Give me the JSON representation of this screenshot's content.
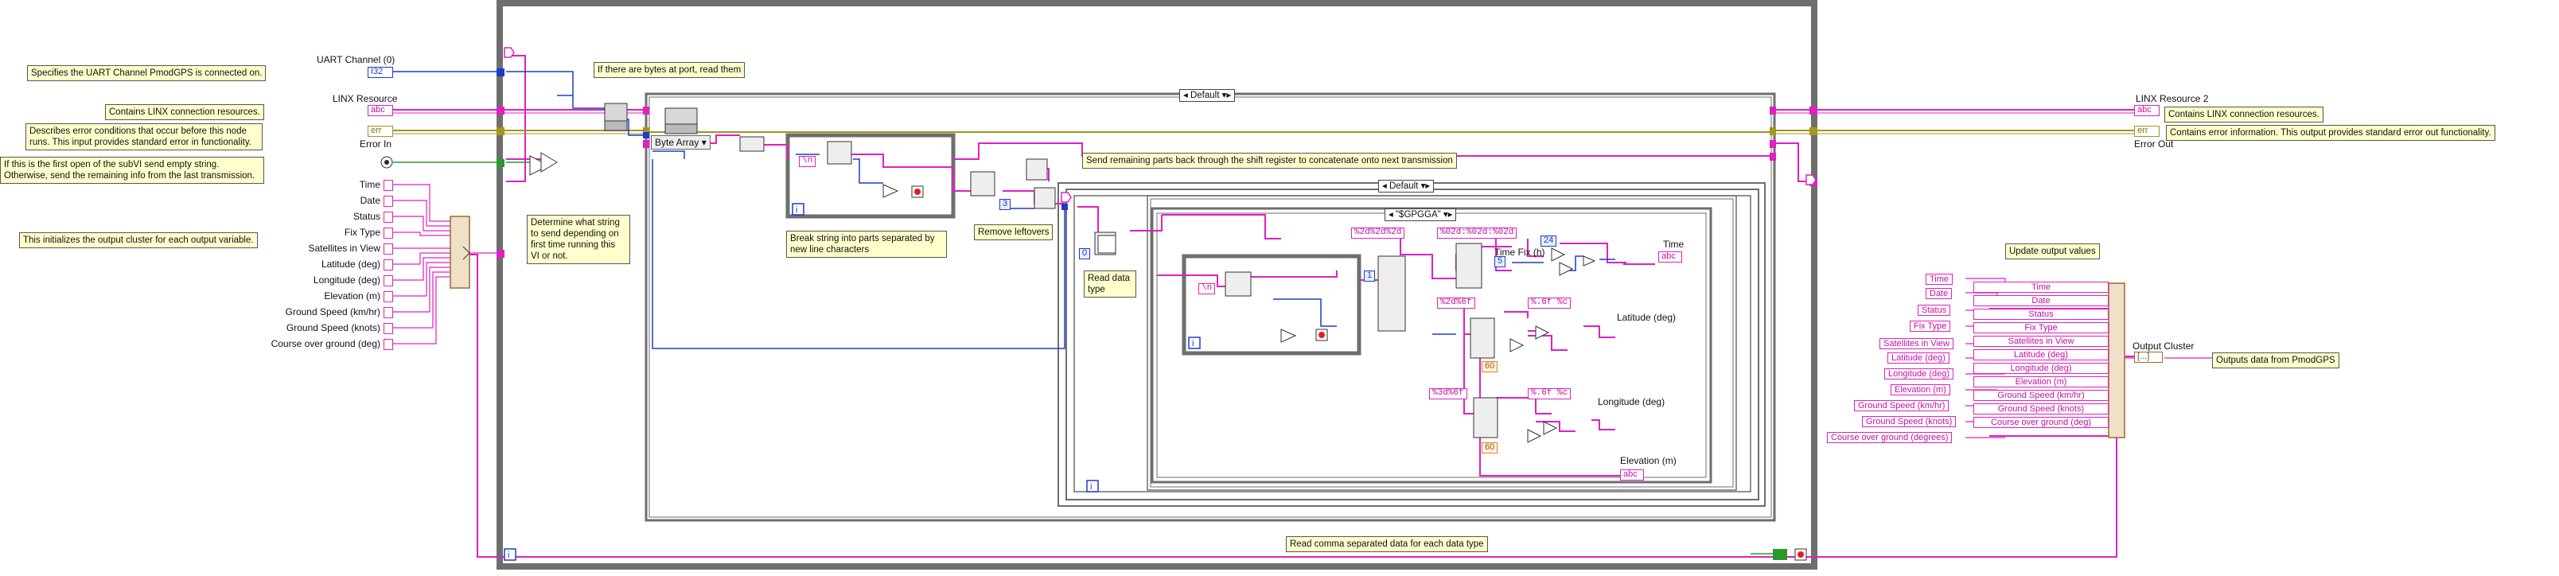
{
  "notes": {
    "uart": "Specifies the UART Channel PmodGPS is connected on.",
    "linx_in": "Contains LINX connection resources.",
    "error_in": [
      "Describes error conditions that occur before this node",
      "runs.  This input provides standard error in functionality."
    ],
    "first_open": [
      "If this is the first open of the subVI send empty string.",
      "Otherwise, send the remaining info from the last transmission."
    ],
    "init_cluster": "This initializes the output cluster for each output variable.",
    "determine": [
      "Determine what string",
      "to send depending on",
      "first time running this",
      "VI or not."
    ],
    "bytes_at_port": "If there are bytes at port, read them",
    "break_string": [
      "Break string into parts separated by",
      "new line characters"
    ],
    "remove_leftovers": "Remove leftovers",
    "send_remaining": "Send remaining parts back through the shift register to concatenate onto next transmission",
    "read_type": [
      "Read data",
      "type"
    ],
    "read_comma": "Read comma separated data for each data type",
    "update_output": "Update output values",
    "linx_out": "Contains LINX connection resources.",
    "error_out": "Contains error information.  This output provides standard error out functionality.",
    "outputs_pmod": "Outputs data from PmodGPS"
  },
  "terminals": {
    "uart_channel": "UART Channel (0)",
    "linx_resource": "LINX Resource",
    "error_in": "Error In",
    "linx_resource_2": "LINX Resource 2",
    "error_out": "Error Out",
    "output_cluster": "Output Cluster"
  },
  "init_fields": [
    "Time",
    "Date",
    "Status",
    "Fix Type",
    "Satellites in View",
    "Latitude (deg)",
    "Longitude (deg)",
    "Elevation (m)",
    "Ground Speed (km/hr)",
    "Ground Speed (knots)",
    "Course over ground (deg)"
  ],
  "bundle_inputs": [
    "Time",
    "Date",
    "Status",
    "Fix Type",
    "Satellites in View",
    "Latitude (deg)",
    "Longitude (deg)",
    "Elevation (m)",
    "Ground Speed (km/hr)",
    "Ground Speed (knots)",
    "Course over ground (degrees)"
  ],
  "bundle_fields": [
    "Time",
    "Date",
    "Status",
    "Fix Type",
    "Satellites in View",
    "Latitude (deg)",
    "Longitude (deg)",
    "Elevation (m)",
    "Ground Speed (km/hr)",
    "Ground Speed (knots)",
    "Course over ground (deg)"
  ],
  "cases": {
    "outer": "Default",
    "inner_type": "Default",
    "gpgga": "\"$GPGGA\""
  },
  "constants": {
    "byte_array": "Byte Array",
    "newline": "\\n",
    "fmt_time": "%2d%2d%2d",
    "fmt_time_out": "%02d:%02d:%02d",
    "fmt_lat": "%2d%6f",
    "fmt_lat_out": "%.6f %c",
    "fmt_lon": "%3d%6f",
    "fmt_lon_out": "%.6f %c",
    "sixty_a": "60",
    "sixty_b": "60",
    "num_24": "24",
    "num_3": "3",
    "num_0": "0",
    "num_1": "1",
    "num_5": "5"
  },
  "inner_labels": {
    "time_fix": "Time Fix (h)",
    "time": "Time",
    "latitude": "Latitude (deg)",
    "longitude": "Longitude (deg)",
    "elevation": "Elevation (m)"
  },
  "loop_iter": "i",
  "colors": {
    "string": "#e020c0",
    "error": "#a0961e",
    "integer": "#1e3cc8",
    "boolean": "#2a9a2a",
    "cluster": "#9a6a30",
    "note_bg": "#ffffcc"
  }
}
